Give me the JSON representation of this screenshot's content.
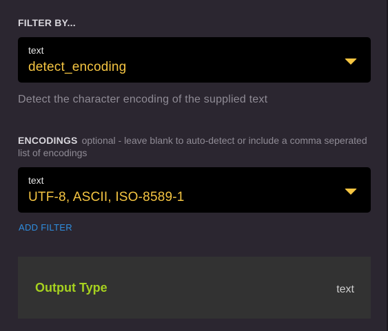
{
  "filter_section": {
    "title": "FILTER BY...",
    "select": {
      "type_label": "text",
      "value": "detect_encoding",
      "caret_icon": "caret-down-icon"
    },
    "description": "Detect the character encoding of the supplied text"
  },
  "encodings_section": {
    "label": "ENCODINGS",
    "hint": "optional - leave blank to auto-detect or include a comma seperated list of encodings",
    "select": {
      "type_label": "text",
      "value": "UTF-8, ASCII, ISO-8589-1",
      "caret_icon": "caret-down-icon"
    }
  },
  "add_filter_label": "ADD FILTER",
  "output": {
    "label": "Output Type",
    "value": "text"
  },
  "colors": {
    "background": "#2b2630",
    "accent_yellow": "#f5c542",
    "link_blue": "#2f8fe0",
    "output_green": "#a6d11f"
  }
}
